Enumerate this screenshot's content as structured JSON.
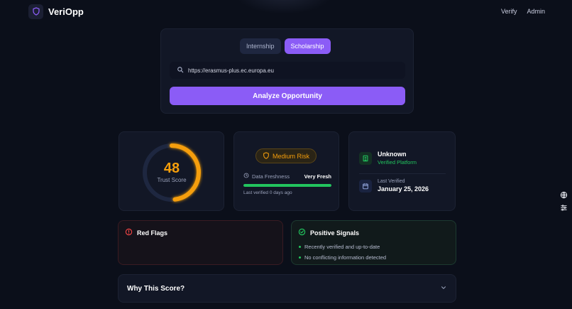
{
  "app": {
    "name": "VeriOpp",
    "nav": [
      {
        "label": "Verify"
      },
      {
        "label": "Admin"
      }
    ]
  },
  "search": {
    "tabs": [
      {
        "label": "Internship",
        "active": false
      },
      {
        "label": "Scholarship",
        "active": true
      }
    ],
    "url_value": "https://erasmus-plus.ec.europa.eu",
    "analyze_label": "Analyze Opportunity"
  },
  "score": {
    "value": "48",
    "value_num": 48,
    "label": "Trust Score",
    "color": "#f59e0b"
  },
  "risk": {
    "level": "Medium Risk",
    "freshness_label": "Data Freshness",
    "freshness_value": "Very Fresh",
    "freshness_fraction": 1.0,
    "last_verified_text": "Last verified 0 days ago"
  },
  "meta": {
    "platform_status": "Unknown",
    "platform_sub": "Verified Platform",
    "last_verified_label": "Last Verified",
    "last_verified_date": "January 25, 2026"
  },
  "red_flags": {
    "title": "Red Flags",
    "items": []
  },
  "positive_signals": {
    "title": "Positive Signals",
    "items": [
      "Recently verified and up-to-date",
      "No conflicting information detected"
    ]
  },
  "why": {
    "title": "Why This Score?"
  },
  "colors": {
    "accent": "#8b5cf6",
    "warning": "#f59e0b",
    "success": "#22c55e",
    "danger": "#ef4444",
    "background": "#0b0f1a",
    "card": "#121726"
  },
  "icons": {
    "logo": "shield-icon",
    "search": "search-icon",
    "risk": "shield-icon",
    "freshness": "clock-icon",
    "platform": "building-icon",
    "calendar": "calendar-icon",
    "red_flags": "alert-circle-icon",
    "positive": "check-circle-icon",
    "expand": "chevron-down-icon",
    "language": "globe-icon",
    "settings": "sliders-icon"
  }
}
